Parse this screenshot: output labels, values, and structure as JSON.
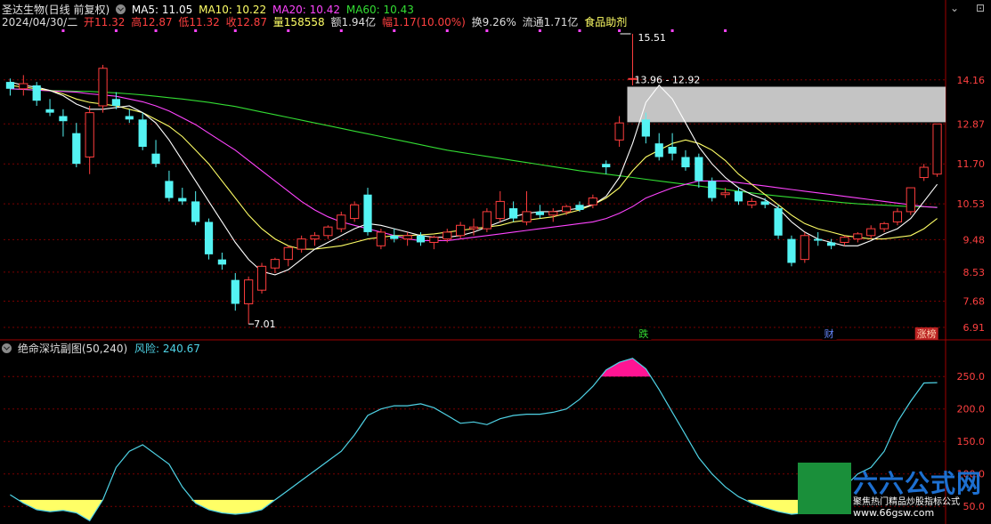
{
  "header": {
    "stock_name": "圣达生物(日线 前复权)",
    "ma5_label": "MA5: 11.05",
    "ma10_label": "MA10: 10.22",
    "ma20_label": "MA20: 10.42",
    "ma60_label": "MA60: 10.43",
    "date": "2024/04/30/二",
    "open": "开11.32",
    "high": "高12.87",
    "low": "低11.32",
    "close": "收12.87",
    "volume": "量158558",
    "amount": "额1.94亿",
    "amplitude": "幅1.17(10.00%)",
    "turnover": "换9.26%",
    "float": "流通1.71亿",
    "sector": "食品助剂"
  },
  "window_icons": [
    "⌄",
    "⊡"
  ],
  "sub_header": {
    "indicator_name": "绝命深坑副图(50,240)",
    "risk_label": "风险: 240.67"
  },
  "colors": {
    "up": "#ff3d3d",
    "down": "#54f3f3",
    "ma5": "#ffffff",
    "ma10": "#ffff66",
    "ma20": "#ff44ff",
    "ma60": "#33dd33",
    "risk_line": "#4fd3e6",
    "risk_high_fill": "#ff1493",
    "risk_low_fill": "#ffff66",
    "grid": "#7a0000",
    "axis_text": "#ff4040"
  },
  "price_axis": [
    "14.16",
    "12.87",
    "11.70",
    "10.53",
    "9.48",
    "8.53",
    "7.68",
    "6.91"
  ],
  "risk_axis": [
    "250.0",
    "200.0",
    "150.0",
    "100.0",
    "50.0"
  ],
  "annotations": {
    "high_label": "15.51",
    "low_label": "7.01",
    "range_label": "13.96 - 12.92",
    "event_die": "跌",
    "event_cai": "财",
    "event_zhang": "涨榜"
  },
  "watermark": {
    "main": "六六公式网",
    "sub": "聚焦热门精品炒股指标公式",
    "url": "www.66gsw.com"
  },
  "chart_data": {
    "type": "candlestick",
    "price_range": [
      6.91,
      15.51
    ],
    "candles": [
      [
        14.1,
        14.2,
        13.7,
        13.9
      ],
      [
        13.9,
        14.3,
        13.7,
        14.05
      ],
      [
        14.0,
        14.1,
        13.4,
        13.55
      ],
      [
        13.3,
        13.6,
        13.1,
        13.2
      ],
      [
        13.1,
        13.3,
        12.5,
        12.95
      ],
      [
        12.6,
        12.9,
        11.6,
        11.7
      ],
      [
        11.9,
        13.4,
        11.4,
        13.2
      ],
      [
        13.4,
        14.6,
        13.2,
        14.5
      ],
      [
        13.6,
        13.8,
        13.3,
        13.4
      ],
      [
        13.1,
        13.3,
        12.9,
        13.0
      ],
      [
        13.0,
        13.2,
        12.1,
        12.2
      ],
      [
        12.0,
        12.4,
        11.6,
        11.7
      ],
      [
        11.2,
        11.5,
        10.6,
        10.7
      ],
      [
        10.7,
        11.0,
        10.5,
        10.6
      ],
      [
        10.6,
        10.9,
        9.9,
        10.0
      ],
      [
        10.0,
        10.1,
        8.9,
        9.05
      ],
      [
        8.9,
        9.1,
        8.6,
        8.75
      ],
      [
        8.3,
        8.5,
        7.4,
        7.6
      ],
      [
        7.6,
        8.4,
        7.01,
        8.3
      ],
      [
        8.0,
        8.8,
        7.9,
        8.7
      ],
      [
        8.65,
        8.95,
        8.5,
        8.9
      ],
      [
        8.9,
        9.3,
        8.7,
        9.25
      ],
      [
        9.2,
        9.6,
        9.1,
        9.5
      ],
      [
        9.5,
        9.7,
        9.3,
        9.6
      ],
      [
        9.6,
        9.9,
        9.5,
        9.85
      ],
      [
        9.8,
        10.3,
        9.7,
        10.2
      ],
      [
        10.1,
        10.6,
        10.0,
        10.5
      ],
      [
        10.8,
        11.0,
        9.6,
        9.7
      ],
      [
        9.3,
        9.8,
        9.2,
        9.7
      ],
      [
        9.6,
        9.8,
        9.4,
        9.5
      ],
      [
        9.5,
        9.7,
        9.3,
        9.6
      ],
      [
        9.6,
        9.7,
        9.3,
        9.4
      ],
      [
        9.4,
        9.6,
        9.2,
        9.55
      ],
      [
        9.5,
        9.8,
        9.4,
        9.7
      ],
      [
        9.6,
        10.0,
        9.5,
        9.9
      ],
      [
        9.8,
        10.1,
        9.6,
        9.85
      ],
      [
        9.8,
        10.4,
        9.7,
        10.3
      ],
      [
        10.1,
        10.9,
        10.0,
        10.6
      ],
      [
        10.4,
        10.6,
        10.0,
        10.1
      ],
      [
        10.0,
        10.9,
        9.9,
        10.3
      ],
      [
        10.3,
        10.5,
        10.1,
        10.2
      ],
      [
        10.2,
        10.4,
        10.0,
        10.3
      ],
      [
        10.3,
        10.5,
        10.2,
        10.45
      ],
      [
        10.5,
        10.6,
        10.3,
        10.35
      ],
      [
        10.5,
        10.8,
        10.4,
        10.7
      ],
      [
        11.7,
        11.8,
        11.4,
        11.6
      ],
      [
        12.4,
        13.1,
        12.2,
        12.9
      ],
      [
        14.2,
        15.51,
        14.0,
        14.2
      ],
      [
        13.0,
        13.2,
        12.3,
        12.5
      ],
      [
        12.3,
        12.6,
        11.8,
        11.9
      ],
      [
        12.2,
        12.6,
        11.8,
        12.0
      ],
      [
        11.9,
        12.1,
        11.5,
        11.6
      ],
      [
        11.9,
        12.0,
        11.0,
        11.2
      ],
      [
        11.2,
        11.3,
        10.6,
        10.7
      ],
      [
        10.8,
        11.0,
        10.7,
        10.85
      ],
      [
        10.9,
        11.0,
        10.5,
        10.6
      ],
      [
        10.5,
        10.7,
        10.4,
        10.6
      ],
      [
        10.6,
        10.7,
        10.4,
        10.5
      ],
      [
        10.4,
        10.5,
        9.5,
        9.6
      ],
      [
        9.5,
        9.6,
        8.7,
        8.8
      ],
      [
        8.9,
        9.7,
        8.8,
        9.6
      ],
      [
        9.5,
        9.7,
        9.3,
        9.45
      ],
      [
        9.4,
        9.5,
        9.2,
        9.3
      ],
      [
        9.4,
        9.6,
        9.3,
        9.55
      ],
      [
        9.5,
        9.7,
        9.4,
        9.65
      ],
      [
        9.6,
        9.9,
        9.5,
        9.8
      ],
      [
        9.8,
        10.0,
        9.7,
        9.95
      ],
      [
        10.0,
        10.4,
        9.9,
        10.3
      ],
      [
        10.3,
        11.0,
        10.2,
        11.0
      ],
      [
        11.3,
        11.7,
        11.2,
        11.6
      ],
      [
        11.4,
        12.87,
        11.32,
        12.87
      ]
    ],
    "ma5": [
      14.1,
      14.0,
      13.95,
      13.85,
      13.7,
      13.45,
      13.3,
      13.3,
      13.35,
      13.4,
      13.2,
      12.9,
      12.4,
      11.8,
      11.2,
      10.6,
      10.0,
      9.4,
      8.9,
      8.55,
      8.45,
      8.6,
      8.9,
      9.2,
      9.4,
      9.6,
      9.8,
      9.95,
      9.9,
      9.8,
      9.7,
      9.6,
      9.55,
      9.55,
      9.6,
      9.7,
      9.85,
      10.0,
      10.15,
      10.25,
      10.3,
      10.3,
      10.35,
      10.4,
      10.5,
      10.75,
      11.3,
      12.3,
      13.5,
      14.0,
      13.6,
      12.9,
      12.2,
      11.7,
      11.3,
      11.0,
      10.8,
      10.65,
      10.4,
      10.0,
      9.7,
      9.5,
      9.4,
      9.3,
      9.3,
      9.45,
      9.65,
      9.8,
      10.1,
      10.6,
      11.1
    ],
    "ma10": [
      14.0,
      13.95,
      13.9,
      13.85,
      13.75,
      13.6,
      13.5,
      13.45,
      13.4,
      13.3,
      13.2,
      13.0,
      12.8,
      12.5,
      12.1,
      11.7,
      11.2,
      10.7,
      10.2,
      9.8,
      9.5,
      9.3,
      9.2,
      9.2,
      9.25,
      9.3,
      9.4,
      9.5,
      9.55,
      9.6,
      9.6,
      9.62,
      9.65,
      9.7,
      9.75,
      9.8,
      9.85,
      9.9,
      10.0,
      10.05,
      10.1,
      10.15,
      10.25,
      10.35,
      10.5,
      10.7,
      11.0,
      11.5,
      11.9,
      12.1,
      12.3,
      12.4,
      12.3,
      12.1,
      11.8,
      11.4,
      11.1,
      10.8,
      10.5,
      10.2,
      9.95,
      9.8,
      9.7,
      9.6,
      9.55,
      9.5,
      9.5,
      9.55,
      9.6,
      9.8,
      10.1
    ],
    "ma20": [
      13.9,
      13.88,
      13.86,
      13.84,
      13.82,
      13.8,
      13.75,
      13.72,
      13.68,
      13.6,
      13.52,
      13.4,
      13.25,
      13.05,
      12.85,
      12.6,
      12.35,
      12.1,
      11.8,
      11.5,
      11.2,
      10.9,
      10.6,
      10.35,
      10.15,
      10.0,
      9.9,
      9.8,
      9.7,
      9.6,
      9.5,
      9.45,
      9.45,
      9.45,
      9.5,
      9.55,
      9.6,
      9.65,
      9.7,
      9.75,
      9.8,
      9.85,
      9.9,
      9.95,
      10.0,
      10.1,
      10.25,
      10.45,
      10.7,
      10.85,
      11.0,
      11.1,
      11.2,
      11.2,
      11.2,
      11.15,
      11.1,
      11.05,
      11.0,
      10.95,
      10.9,
      10.85,
      10.8,
      10.75,
      10.7,
      10.65,
      10.6,
      10.55,
      10.5,
      10.45,
      10.42
    ],
    "ma60": [
      13.9,
      13.88,
      13.86,
      13.85,
      13.84,
      13.83,
      13.82,
      13.8,
      13.78,
      13.75,
      13.72,
      13.68,
      13.64,
      13.6,
      13.55,
      13.5,
      13.44,
      13.38,
      13.3,
      13.22,
      13.14,
      13.06,
      12.98,
      12.9,
      12.82,
      12.74,
      12.66,
      12.58,
      12.5,
      12.42,
      12.34,
      12.26,
      12.18,
      12.1,
      12.04,
      11.98,
      11.92,
      11.86,
      11.8,
      11.74,
      11.68,
      11.62,
      11.56,
      11.5,
      11.45,
      11.4,
      11.35,
      11.3,
      11.25,
      11.2,
      11.15,
      11.1,
      11.05,
      11.0,
      10.95,
      10.9,
      10.85,
      10.8,
      10.76,
      10.72,
      10.68,
      10.64,
      10.6,
      10.56,
      10.53,
      10.51,
      10.49,
      10.47,
      10.45,
      10.44,
      10.43
    ],
    "risk_range": [
      38,
      275
    ],
    "risk": [
      68,
      55,
      45,
      42,
      44,
      40,
      28,
      60,
      110,
      135,
      145,
      130,
      115,
      80,
      55,
      45,
      40,
      38,
      40,
      45,
      60,
      75,
      90,
      105,
      120,
      135,
      160,
      190,
      200,
      205,
      205,
      208,
      202,
      190,
      178,
      180,
      176,
      185,
      190,
      192,
      192,
      195,
      200,
      215,
      235,
      260,
      272,
      278,
      262,
      230,
      195,
      160,
      125,
      100,
      80,
      65,
      55,
      48,
      42,
      38,
      40,
      48,
      58,
      80,
      100,
      110,
      135,
      180,
      212,
      240,
      240.67
    ],
    "risk_threshold_high": 250,
    "risk_threshold_low": 60
  }
}
